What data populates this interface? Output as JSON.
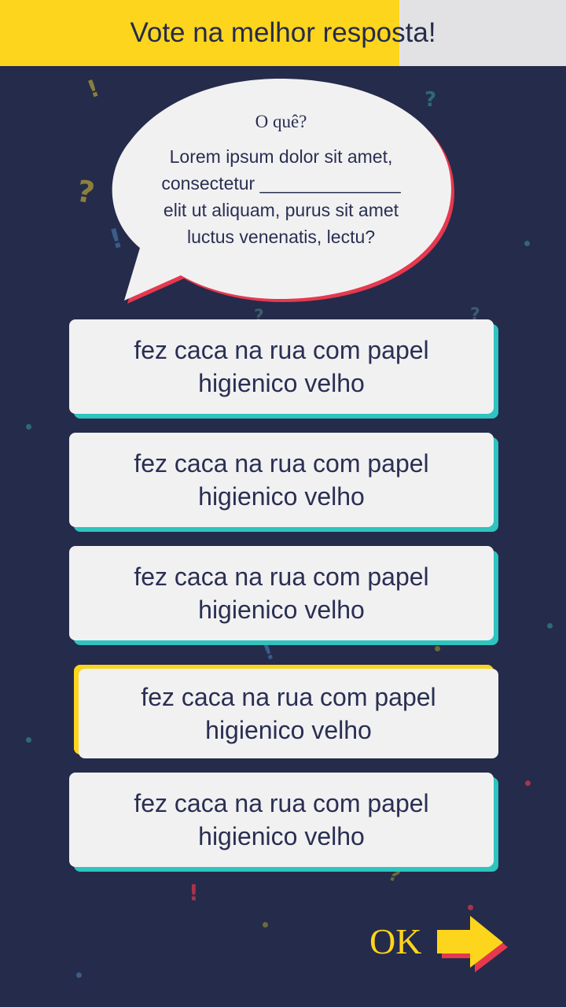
{
  "header": {
    "title": "Vote na melhor resposta!",
    "progress_fraction": 0.706
  },
  "question": {
    "title": "O quê?",
    "lines": [
      "Lorem ipsum dolor sit amet,",
      "consectetur ______________",
      "elit ut aliquam, purus sit amet",
      "luctus venenatis, lectu?"
    ]
  },
  "answers": [
    {
      "line1": "fez caca na rua com papel",
      "line2": "higienico velho",
      "selected": false
    },
    {
      "line1": "fez caca na rua com papel",
      "line2": "higienico velho",
      "selected": false
    },
    {
      "line1": "fez caca na rua com papel",
      "line2": "higienico velho",
      "selected": false
    },
    {
      "line1": "fez caca na rua com papel",
      "line2": "higienico velho",
      "selected": true
    },
    {
      "line1": "fez caca na rua com papel",
      "line2": "higienico velho",
      "selected": false
    }
  ],
  "ok_button": {
    "label": "OK"
  },
  "colors": {
    "background": "#252b4a",
    "accent_yellow": "#fdd51c",
    "accent_teal": "#2ec4bf",
    "accent_red": "#e6384f",
    "text_dark": "#2a2f52",
    "card": "#f1f1f2"
  },
  "icons": {
    "ok_arrow": "right-arrow-icon"
  }
}
